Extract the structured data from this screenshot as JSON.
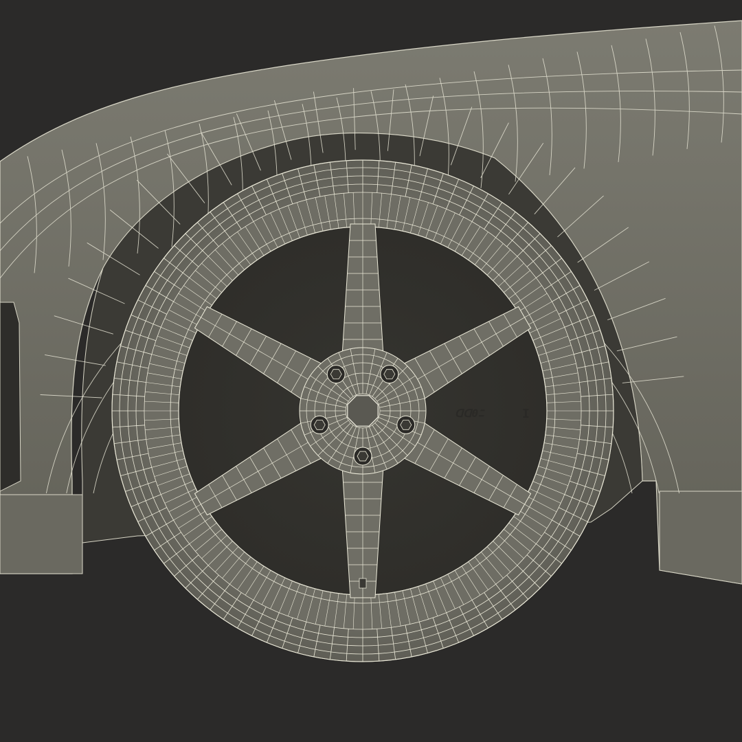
{
  "scene": {
    "subject": "wheel-wireframe-render",
    "colors": {
      "background": "#2b2a29",
      "surface": "#6c6b62",
      "surface_light": "#858479",
      "surface_dark": "#4b4a44",
      "shadow": "#35342f",
      "wire": "#e8e6d6"
    },
    "wheel": {
      "spokes": 6,
      "lug_nuts": 5,
      "rim_marking_left": "ᗡᗡ0ﾆ",
      "rim_marking_right": "I"
    }
  }
}
